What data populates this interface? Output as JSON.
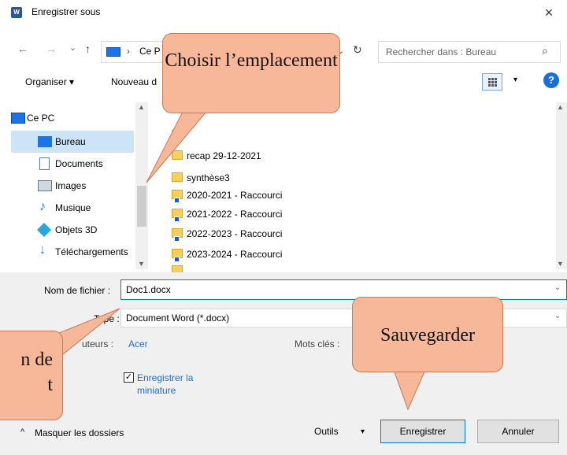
{
  "window": {
    "title": "Enregistrer sous",
    "close_label": "×",
    "app_icon_letter": "W"
  },
  "nav": {
    "back_icon": "←",
    "forward_icon": "→",
    "dropdown_icon": "⌄",
    "up_icon": "↑"
  },
  "address": {
    "chevron": "›",
    "text": "Ce P",
    "dropdown": "⌄",
    "refresh": "↻"
  },
  "search": {
    "placeholder": "Rechercher dans : Bureau",
    "icon": "⌕"
  },
  "toolbar": {
    "organiser": "Organiser ▾",
    "nouveau": "Nouveau d",
    "view_dropdown": "▾",
    "help": "?"
  },
  "sidebar": {
    "items": [
      {
        "label": "Ce PC",
        "icon": "pc-icon",
        "color": "#1a73e8"
      },
      {
        "label": "Bureau",
        "icon": "desktop-icon",
        "color": "#1a73e8"
      },
      {
        "label": "Documents",
        "icon": "documents-icon",
        "color": "#607d8b"
      },
      {
        "label": "Images",
        "icon": "images-icon",
        "color": "#607d8b"
      },
      {
        "label": "Musique",
        "icon": "music-icon",
        "color": "#1a73e8"
      },
      {
        "label": "Objets 3D",
        "icon": "cube-icon",
        "color": "#29a8e0"
      },
      {
        "label": "Téléchargements",
        "icon": "download-icon",
        "color": "#1a73e8"
      }
    ]
  },
  "files": {
    "items": [
      {
        "label": "recap 29-12-2021",
        "shortcut": false
      },
      {
        "label": "synthèse3",
        "shortcut": false
      },
      {
        "label": "2020-2021 - Raccourci",
        "shortcut": true
      },
      {
        "label": "2021-2022 - Raccourci",
        "shortcut": true
      },
      {
        "label": "2022-2023 - Raccourci",
        "shortcut": true
      },
      {
        "label": "2023-2024 - Raccourci",
        "shortcut": true
      }
    ]
  },
  "form": {
    "filename_label": "Nom de fichier :",
    "filename_value": "Doc1.docx",
    "type_label": "Type :",
    "type_value": "Document Word (*.docx)",
    "authors_label": "uteurs :",
    "authors_value": "Acer",
    "keywords_label": "Mots clés :",
    "thumbnail_label": "Enregistrer la miniature",
    "thumbnail_checked": "✓"
  },
  "footer": {
    "hide_folders": "Masquer les dossiers",
    "hide_chevron": "^",
    "tools": "Outils",
    "tools_dropdown": "▾",
    "save": "Enregistrer",
    "cancel": "Annuler"
  },
  "callouts": {
    "location": "Choisir l’emplacement",
    "save": "Sauvegarder",
    "name_part1": "n de",
    "name_part2": "t"
  },
  "colors": {
    "callout_fill": "#f7b89a",
    "accent": "#0078d7"
  }
}
